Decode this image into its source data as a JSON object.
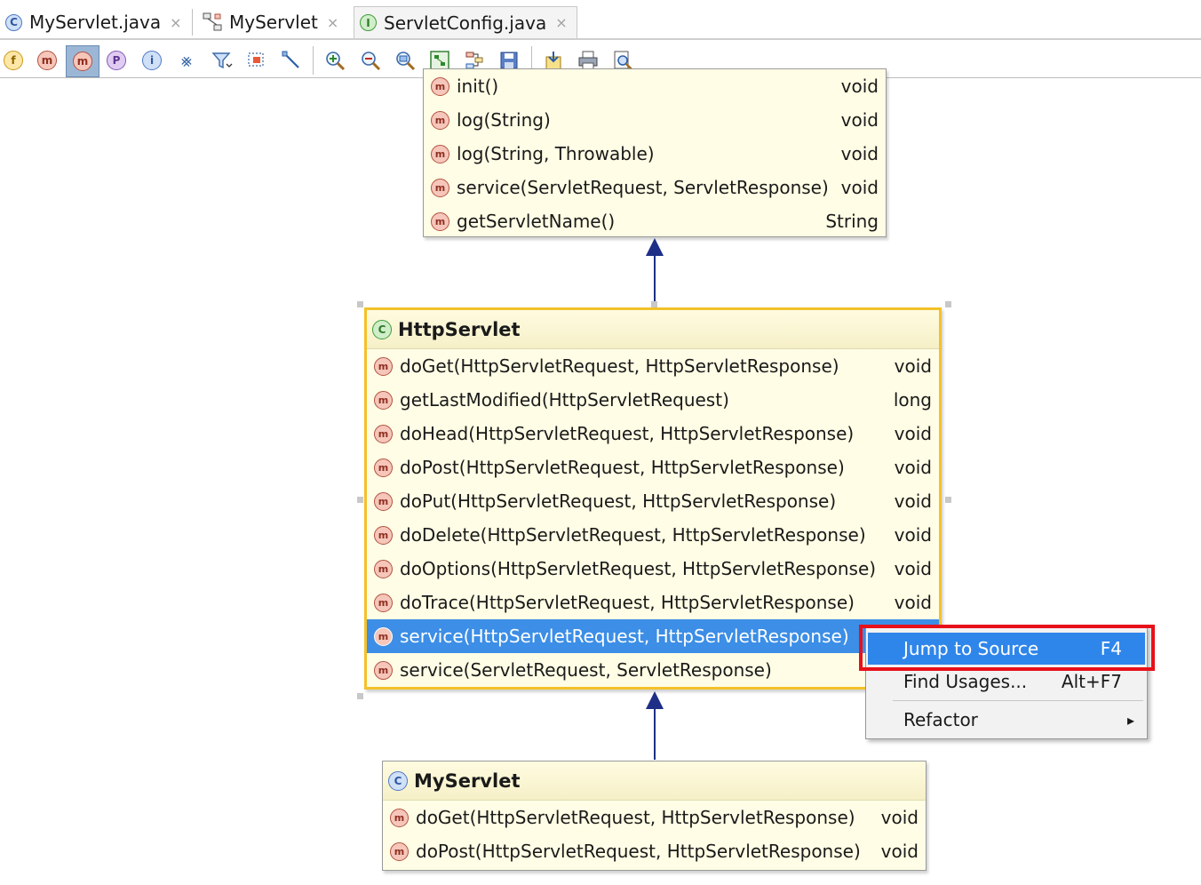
{
  "tabs": [
    {
      "label": "MyServlet.java",
      "icon": "C",
      "close": "×"
    },
    {
      "label": "MyServlet",
      "icon": "diagram",
      "close": "×"
    },
    {
      "label": "ServletConfig.java",
      "icon": "I",
      "close": "×"
    }
  ],
  "toolbar": {
    "icons": [
      "f",
      "m",
      "m",
      "P",
      "i"
    ]
  },
  "parent_class": {
    "methods": [
      {
        "name": "init()",
        "ret": "void"
      },
      {
        "name": "log(String)",
        "ret": "void"
      },
      {
        "name": "log(String, Throwable)",
        "ret": "void"
      },
      {
        "name": "service(ServletRequest, ServletResponse)",
        "ret": "void"
      },
      {
        "name": "getServletName()",
        "ret": "String"
      }
    ]
  },
  "http_servlet": {
    "title": "HttpServlet",
    "methods": [
      {
        "name": "doGet(HttpServletRequest, HttpServletResponse)",
        "ret": "void"
      },
      {
        "name": "getLastModified(HttpServletRequest)",
        "ret": "long"
      },
      {
        "name": "doHead(HttpServletRequest, HttpServletResponse)",
        "ret": "void"
      },
      {
        "name": "doPost(HttpServletRequest, HttpServletResponse)",
        "ret": "void"
      },
      {
        "name": "doPut(HttpServletRequest, HttpServletResponse)",
        "ret": "void"
      },
      {
        "name": "doDelete(HttpServletRequest, HttpServletResponse)",
        "ret": "void"
      },
      {
        "name": "doOptions(HttpServletRequest, HttpServletResponse)",
        "ret": "void"
      },
      {
        "name": "doTrace(HttpServletRequest, HttpServletResponse)",
        "ret": "void"
      },
      {
        "name": "service(HttpServletRequest, HttpServletResponse)",
        "ret": ""
      },
      {
        "name": "service(ServletRequest, ServletResponse)",
        "ret": ""
      }
    ]
  },
  "my_servlet": {
    "title": "MyServlet",
    "methods": [
      {
        "name": "doGet(HttpServletRequest, HttpServletResponse)",
        "ret": "void"
      },
      {
        "name": "doPost(HttpServletRequest, HttpServletResponse)",
        "ret": "void"
      }
    ]
  },
  "context_menu": {
    "jump": {
      "label": "Jump to Source",
      "shortcut": "F4"
    },
    "usages": {
      "label": "Find Usages...",
      "shortcut": "Alt+F7"
    },
    "refactor": {
      "label": "Refactor",
      "submenu": "▸"
    }
  },
  "method_icon_letter": "m",
  "abstract_icon_letter": "C",
  "class_icon_letter": "C",
  "colors": {
    "selection": "#3c8ee6",
    "selected_border": "#f3c12a",
    "highlight_box": "#e8101a",
    "arrow": "#1d2f86"
  }
}
